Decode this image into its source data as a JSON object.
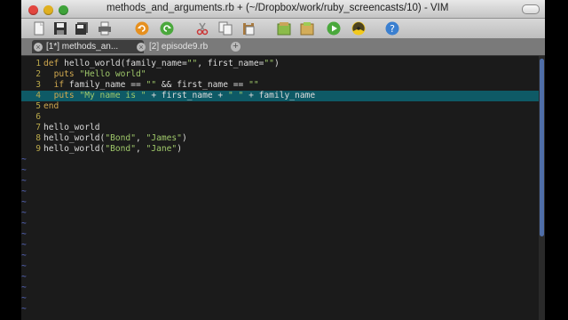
{
  "window": {
    "title": "methods_and_arguments.rb + (~/Dropbox/work/ruby_screencasts/10) - VIM"
  },
  "toolbar": {
    "buttons": [
      "open-icon",
      "save-icon",
      "save-all-icon",
      "print-icon",
      "undo-icon",
      "redo-icon",
      "cut-icon",
      "copy-icon",
      "paste-icon",
      "find-icon",
      "replace-icon",
      "run-icon",
      "build-icon",
      "help-icon"
    ]
  },
  "tabs": [
    {
      "label": "[1*] methods_an...",
      "active": true
    },
    {
      "label": "[2] episode9.rb",
      "active": false
    }
  ],
  "editor": {
    "lines": [
      {
        "num": "1",
        "text": "def hello_world(family_name=\"\", first_name=\"\")"
      },
      {
        "num": "2",
        "text": "  puts \"Hello world\""
      },
      {
        "num": "3",
        "text": "  if family_name == \"\" && first_name == \"\""
      },
      {
        "num": "4",
        "text": "  puts \"My name is \" + first_name + \" \" + family_name"
      },
      {
        "num": "5",
        "text": "end"
      },
      {
        "num": "6",
        "text": ""
      },
      {
        "num": "7",
        "text": "hello_world"
      },
      {
        "num": "8",
        "text": "hello_world(\"Bond\", \"James\")"
      },
      {
        "num": "9",
        "text": "hello_world(\"Bond\", \"Jane\")"
      }
    ],
    "tilde": "~",
    "cursor_line": 4
  }
}
